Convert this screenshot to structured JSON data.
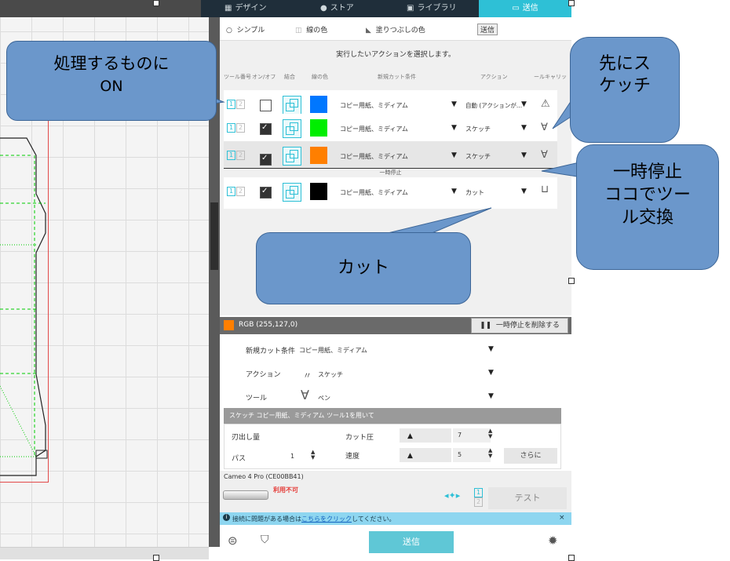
{
  "nav": {
    "tabs": [
      {
        "label": "デザイン",
        "icon": "grid-icon"
      },
      {
        "label": "ストア",
        "icon": "store-icon"
      },
      {
        "label": "ライブラリ",
        "icon": "library-icon"
      },
      {
        "label": "送信",
        "icon": "cutter-icon"
      }
    ]
  },
  "modes": {
    "simple": "シンプル",
    "line_color": "線の色",
    "fill_color": "塗りつぶしの色",
    "send_tag": "送信"
  },
  "prompt": "実行したいアクションを選択します。",
  "headers": {
    "tool_no": "ツール番号",
    "onoff": "オン/オフ",
    "combine": "結合",
    "line_color": "線の色",
    "cut_condition": "新規カット条件",
    "action": "アクション",
    "carriage": "ールキャリッ"
  },
  "rows": [
    {
      "tool": [
        "1",
        "2"
      ],
      "checked": false,
      "color": "#0077ff",
      "condition": "コピー用紙、ミディアム",
      "action": "自動 (アクションが...",
      "tool_icon": "warning-icon"
    },
    {
      "tool": [
        "1",
        "2"
      ],
      "checked": true,
      "color": "#00ee00",
      "condition": "コピー用紙、ミディアム",
      "action": "スケッチ",
      "tool_icon": "pen-icon"
    },
    {
      "tool": [
        "1",
        "2"
      ],
      "checked": true,
      "color": "#ff7f00",
      "condition": "コピー用紙、ミディアム",
      "action": "スケッチ",
      "tool_icon": "pen-icon"
    },
    {
      "tool": [
        "1",
        "2"
      ],
      "checked": true,
      "color": "#000000",
      "condition": "コピー用紙、ミディアム",
      "action": "カット",
      "tool_icon": "blade-icon"
    }
  ],
  "pause_label": "一時停止",
  "selected_color": {
    "label": "RGB (255,127,0)",
    "color": "#ff7f00",
    "remove_pause": "一時停止を削除する"
  },
  "settings": {
    "cut_condition_label": "新規カット条件",
    "cut_condition_value": "コピー用紙、ミディアム",
    "action_label": "アクション",
    "action_value": "スケッチ",
    "tool_label": "ツール",
    "tool_value": "ペン",
    "summary": "スケッチ コピー用紙、ミディアム ツール1を用いて",
    "blade_depth_label": "刃出し量",
    "passes_label": "パス",
    "passes_value": "1",
    "force_label": "カット圧",
    "force_value": "7",
    "speed_label": "速度",
    "speed_value": "5",
    "more_button": "さらに"
  },
  "device": {
    "name": "Cameo 4 Pro (CE00BB41)",
    "status": "利用不可",
    "test_button": "テスト"
  },
  "info": {
    "text_before": "接続に問題がある場合は",
    "link": "こちらをクリック",
    "text_after": "してください。",
    "close": "×"
  },
  "send_button": "送信",
  "callouts": {
    "on": [
      "処理するものに",
      "ON"
    ],
    "sketch": [
      "先にス",
      "ケッチ"
    ],
    "pause": [
      "一時停止",
      "ココでツー",
      "ル交換"
    ],
    "cut": "カット"
  }
}
